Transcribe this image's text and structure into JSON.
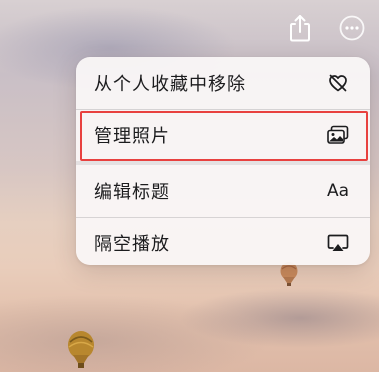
{
  "menu": {
    "items": [
      {
        "label": "从个人收藏中移除",
        "icon": "heart-slash-icon"
      },
      {
        "label": "管理照片",
        "icon": "photos-stack-icon"
      },
      {
        "label": "编辑标题",
        "icon": "text-aa-icon",
        "icon_text": "Aa"
      },
      {
        "label": "隔空播放",
        "icon": "airplay-icon"
      }
    ]
  },
  "toolbar": {
    "icons": [
      "share-icon",
      "more-icon"
    ]
  },
  "colors": {
    "highlight": "#e8413f",
    "menu_background": "#faf7f6",
    "text": "#1c1c1e"
  }
}
